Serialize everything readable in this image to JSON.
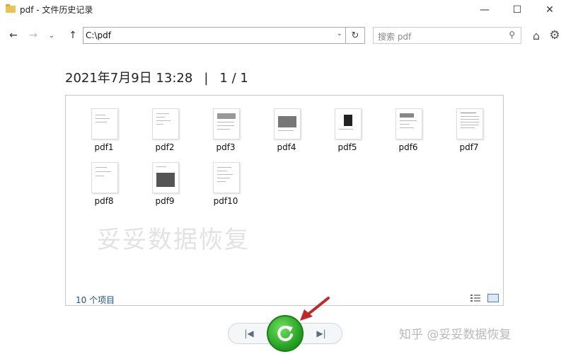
{
  "window": {
    "title": "pdf - 文件历史记录",
    "controls": {
      "minimize": "—",
      "maximize": "☐",
      "close": "✕"
    }
  },
  "nav": {
    "back_icon": "←",
    "forward_icon": "→",
    "recent_icon": "⌄",
    "up_icon": "↑",
    "address": "C:\\pdf",
    "dropdown_icon": "⌄",
    "refresh_icon": "↻",
    "search_placeholder": "搜索 pdf",
    "search_icon": "⚲",
    "home_icon": "⌂",
    "gear_icon": "⚙"
  },
  "header": {
    "datetime": "2021年7月9日 13:28",
    "separator": "|",
    "page": "1 / 1"
  },
  "files": [
    {
      "name": "pdf1"
    },
    {
      "name": "pdf2"
    },
    {
      "name": "pdf3"
    },
    {
      "name": "pdf4"
    },
    {
      "name": "pdf5"
    },
    {
      "name": "pdf6"
    },
    {
      "name": "pdf7"
    },
    {
      "name": "pdf8"
    },
    {
      "name": "pdf9"
    },
    {
      "name": "pdf10"
    }
  ],
  "panel": {
    "watermark": "妥妥数据恢复",
    "item_count": "10 个项目"
  },
  "controls": {
    "prev_icon": "|◀",
    "next_icon": "▶|"
  },
  "footer": {
    "site_watermark": "知乎 @妥妥数据恢复"
  },
  "colors": {
    "restore_green": "#2fb52a",
    "annotation_red": "#c0282a",
    "link_blue": "#1a4f8a"
  }
}
